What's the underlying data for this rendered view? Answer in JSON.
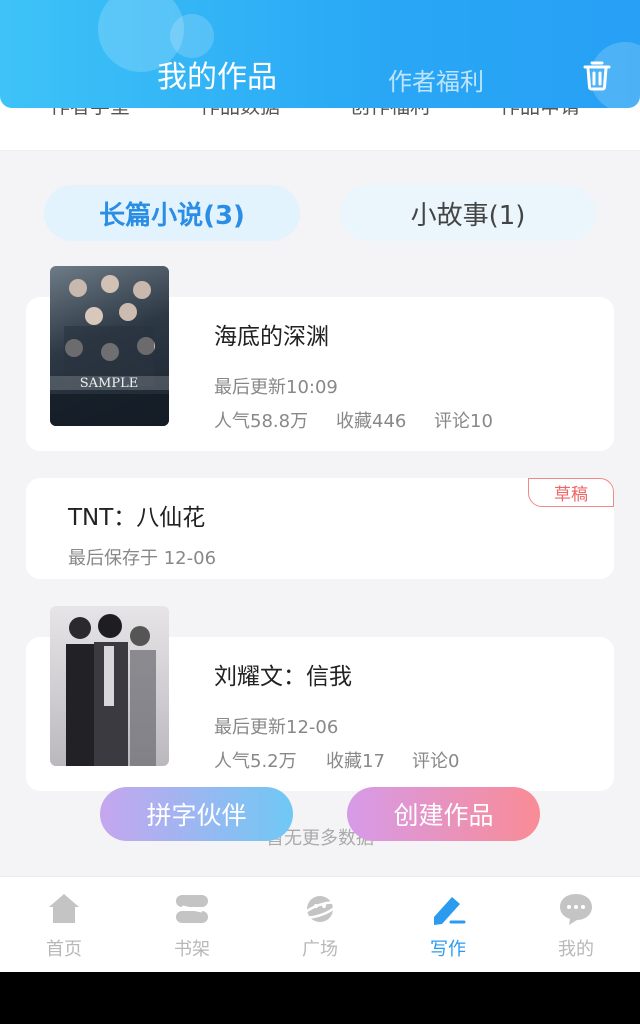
{
  "header": {
    "title": "我的作品",
    "tab2": "作者福利"
  },
  "subrow": [
    "作者学堂",
    "作品数据",
    "创作福利",
    "作品申请"
  ],
  "tabs": [
    {
      "label": "长篇小说(3)",
      "active": true
    },
    {
      "label": "小故事(1)",
      "active": false
    }
  ],
  "works": [
    {
      "title": "海底的深渊",
      "updated": "最后更新10:09",
      "popularity": "人气58.8万",
      "favorites": "收藏446",
      "comments": "评论10",
      "cover_text": "SAMPLE"
    },
    {
      "title": "TNT：八仙花",
      "saved": "最后保存于 12-06",
      "badge": "草稿"
    },
    {
      "title": "刘耀文：信我",
      "updated": "最后更新12-06",
      "popularity": "人气5.2万",
      "favorites": "收藏17",
      "comments": "评论0"
    }
  ],
  "no_more": "暂无更多数据",
  "fab": {
    "left": "拼字伙伴",
    "right": "创建作品"
  },
  "nav": [
    {
      "label": "首页",
      "icon": "home-icon",
      "active": false
    },
    {
      "label": "书架",
      "icon": "bookshelf-icon",
      "active": false
    },
    {
      "label": "广场",
      "icon": "square-planet-icon",
      "active": false
    },
    {
      "label": "写作",
      "icon": "pen-icon",
      "active": true
    },
    {
      "label": "我的",
      "icon": "chat-bubble-icon",
      "active": false
    }
  ],
  "colors": {
    "accent": "#2b9bf0",
    "draft": "#e66666"
  }
}
